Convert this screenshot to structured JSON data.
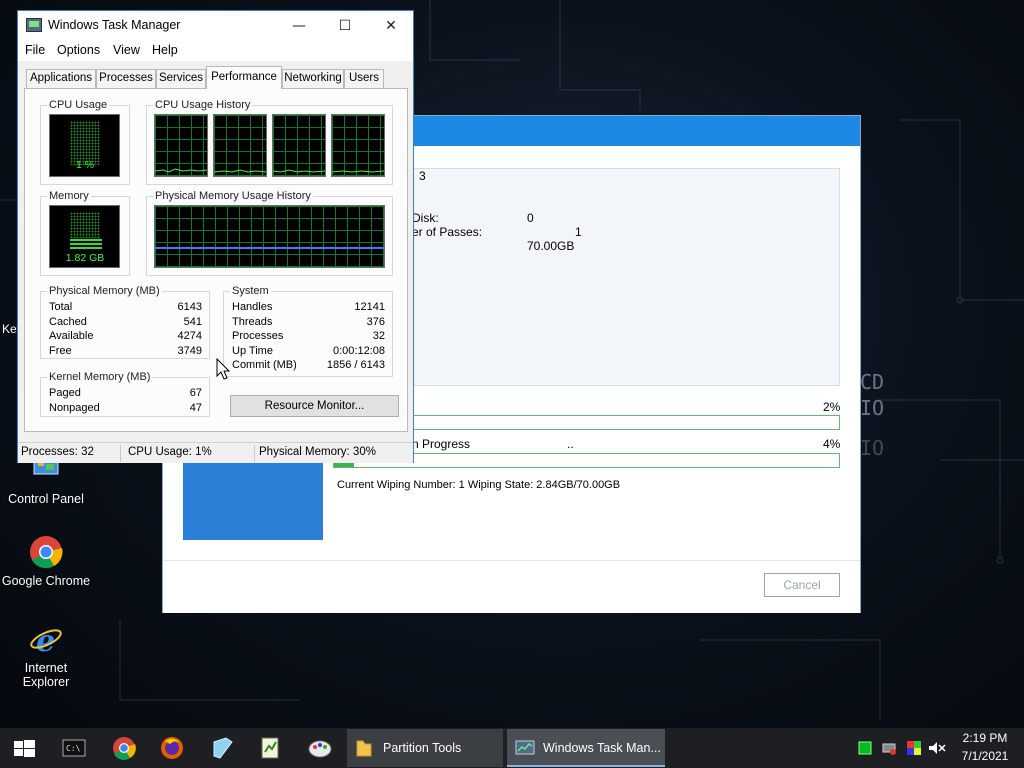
{
  "desktop": {
    "key_text": "Key",
    "icons": [
      {
        "label": "Control Panel",
        "icon": "control-panel-icon"
      },
      {
        "label": "Google Chrome",
        "icon": "chrome-icon"
      },
      {
        "label": "Internet Explorer",
        "icon": "ie-icon"
      }
    ],
    "bg_text": [
      "CD",
      "IO",
      "IO"
    ]
  },
  "wipe_window": {
    "header_num": "3",
    "disk_label": "Disk:",
    "disk_value": "0",
    "passes_label": "er of Passes:",
    "passes_value": "1",
    "size_value": "70.00GB",
    "progress1_pct": "2%",
    "progress1_value": 0.02,
    "progress2_label": "n Progress",
    "progress2_dots": "..",
    "progress2_pct": "4%",
    "progress2_value": 0.04,
    "wiping_number_text": "Current Wiping Number: 1  Wiping State: 2.84GB/70.00GB",
    "cancel_label": "Cancel"
  },
  "taskmanager": {
    "title": "Windows Task Manager",
    "menu": [
      "File",
      "Options",
      "View",
      "Help"
    ],
    "tabs": [
      "Applications",
      "Processes",
      "Services",
      "Performance",
      "Networking",
      "Users"
    ],
    "active_tab": "Performance",
    "cpu_usage": {
      "label": "CPU Usage",
      "value": "1 %"
    },
    "cpu_history": {
      "label": "CPU Usage History"
    },
    "memory": {
      "label": "Memory",
      "value": "1.82 GB"
    },
    "phys_history": {
      "label": "Physical Memory Usage History"
    },
    "physical_memory": {
      "label": "Physical Memory (MB)",
      "rows": [
        {
          "k": "Total",
          "v": "6143"
        },
        {
          "k": "Cached",
          "v": "541"
        },
        {
          "k": "Available",
          "v": "4274"
        },
        {
          "k": "Free",
          "v": "3749"
        }
      ]
    },
    "system": {
      "label": "System",
      "rows": [
        {
          "k": "Handles",
          "v": "12141"
        },
        {
          "k": "Threads",
          "v": "376"
        },
        {
          "k": "Processes",
          "v": "32"
        },
        {
          "k": "Up Time",
          "v": "0:00:12:08"
        },
        {
          "k": "Commit (MB)",
          "v": "1856 / 6143"
        }
      ]
    },
    "kernel_memory": {
      "label": "Kernel Memory (MB)",
      "rows": [
        {
          "k": "Paged",
          "v": "67"
        },
        {
          "k": "Nonpaged",
          "v": "47"
        }
      ]
    },
    "resource_monitor": "Resource Monitor...",
    "status": {
      "processes": "Processes: 32",
      "cpu": "CPU Usage: 1%",
      "memory": "Physical Memory: 30%"
    }
  },
  "taskbar": {
    "buttons": [
      {
        "label": "Partition Tools",
        "icon": "folder-icon"
      },
      {
        "label": "Windows Task Man...",
        "icon": "task-manager-icon"
      }
    ],
    "time": "2:19 PM",
    "date": "7/1/2021"
  },
  "colors": {
    "accent": "#1e88e5",
    "meter_green": "#33ff33",
    "progress_green": "#3fb24f"
  }
}
